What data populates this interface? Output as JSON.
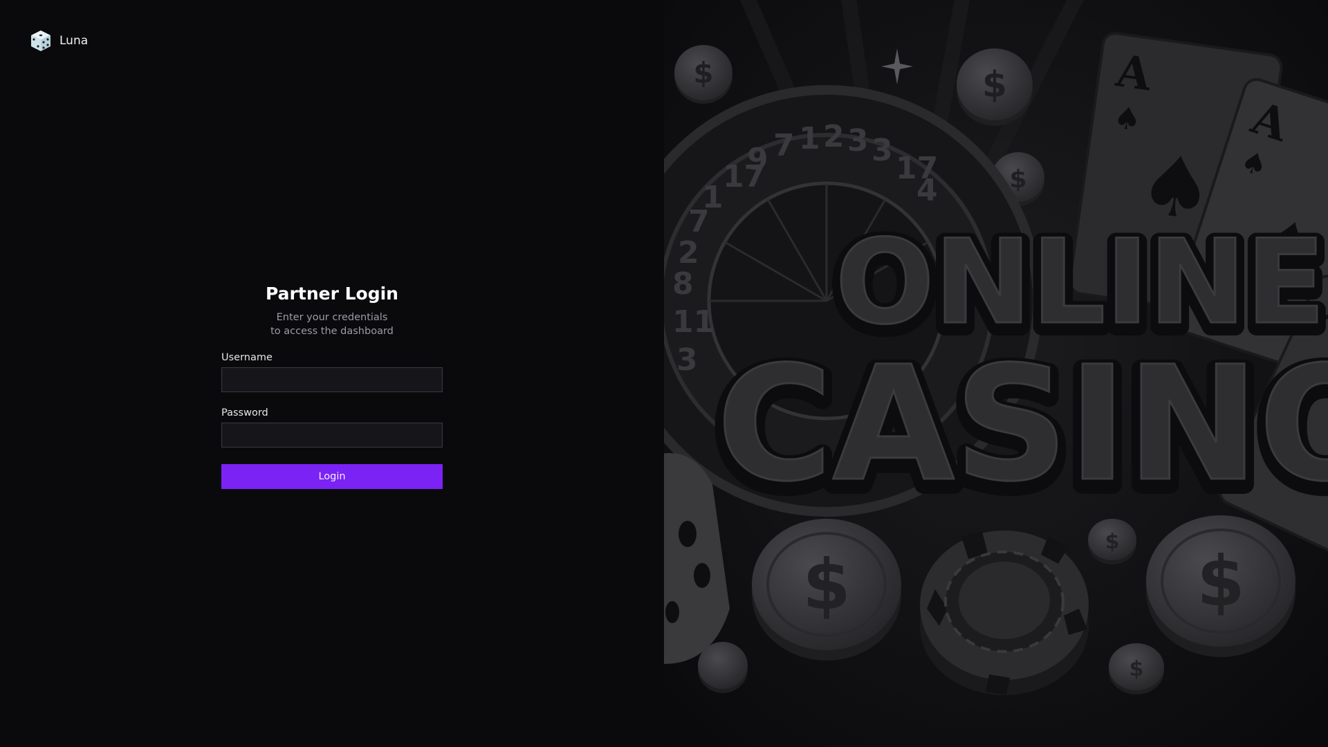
{
  "brand": {
    "name": "Luna",
    "icon": "dice-icon"
  },
  "login": {
    "title": "Partner Login",
    "subtitle_line1": "Enter your credentials",
    "subtitle_line2": "to access the dashboard",
    "username_label": "Username",
    "username_value": "",
    "password_label": "Password",
    "password_value": "",
    "button_label": "Login"
  },
  "hero": {
    "line1": "ONLINE",
    "line2": "CASINO",
    "card_rank": "A",
    "coin_symbol": "$",
    "wheel_numbers": [
      "3",
      "11",
      "8",
      "2",
      "7",
      "1",
      "17",
      "9",
      "7",
      "1",
      "2",
      "3",
      "3",
      "17",
      "4",
      "7"
    ]
  },
  "colors": {
    "accent": "#7b22f5",
    "background": "#0a0a0d",
    "input_bg": "#16161a",
    "input_border": "#3a3a42"
  }
}
